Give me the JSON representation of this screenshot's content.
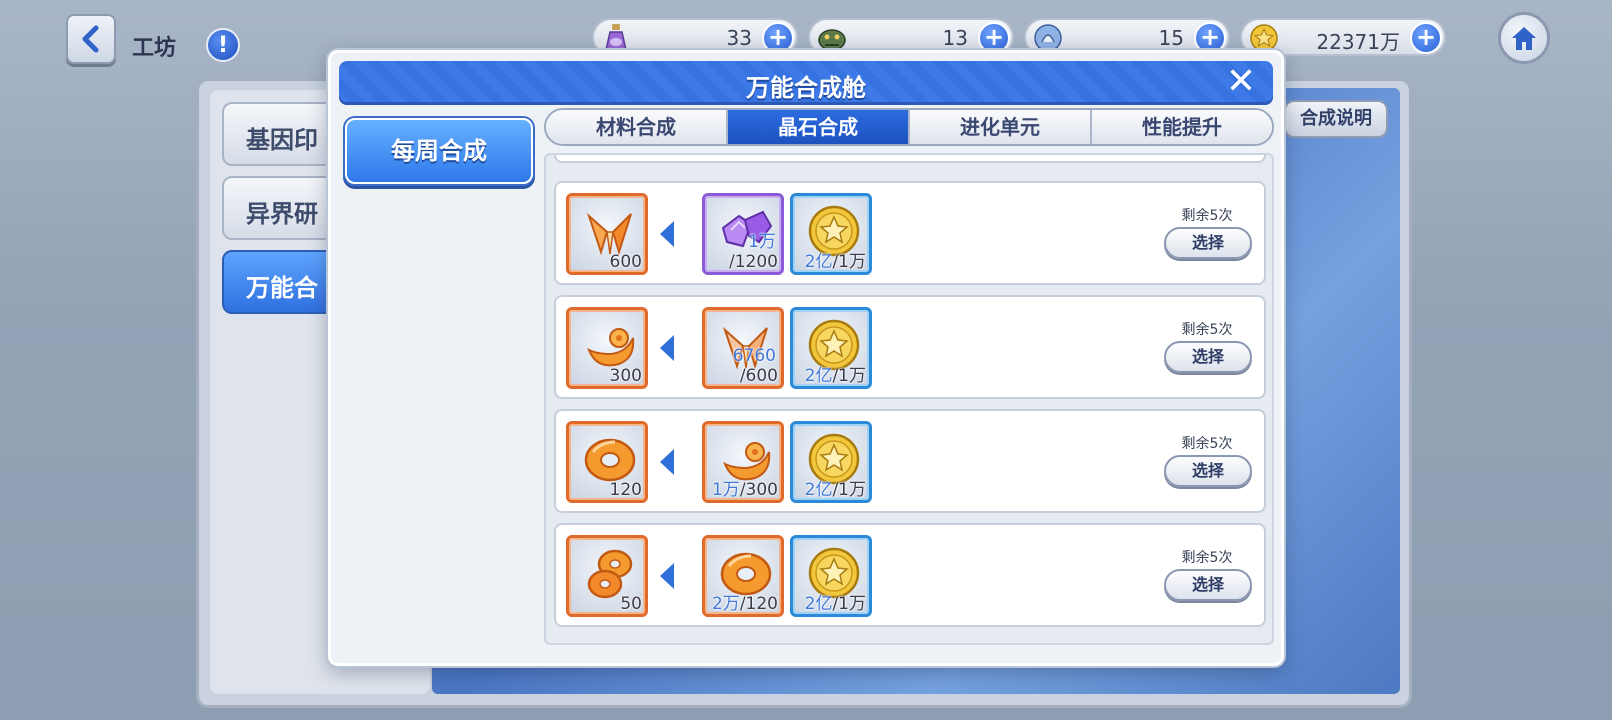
{
  "topbar": {
    "title": "工坊",
    "info_label": "!",
    "resources": [
      {
        "icon": "potion-bottle-icon",
        "value": "33"
      },
      {
        "icon": "dragon-token-icon",
        "value": "13"
      },
      {
        "icon": "badge-coin-icon",
        "value": "15"
      },
      {
        "icon": "gold-coin-icon",
        "value": "22371万"
      }
    ]
  },
  "background": {
    "side_tabs": [
      "基因印",
      "异界研",
      "万能合"
    ],
    "help_button": "合成说明"
  },
  "modal": {
    "title": "万能合成舱",
    "close_label": "✕",
    "weekly_button": "每周合成",
    "tabs": [
      "材料合成",
      "晶石合成",
      "进化单元",
      "性能提升"
    ],
    "active_tab": 1,
    "rows": [
      {
        "result": {
          "icon": "orange-crystal-shard-icon",
          "count": "600"
        },
        "ingredients": [
          {
            "icon": "purple-crystal-icon",
            "have": "1万",
            "need": "/1200",
            "frame": "purple"
          },
          {
            "icon": "gold-star-coin-icon",
            "have": "2亿",
            "need": "/1万",
            "frame": "blue"
          }
        ],
        "remain": "剩余5次",
        "select": "选择"
      },
      {
        "result": {
          "icon": "orange-crescent-icon",
          "count": "300"
        },
        "ingredients": [
          {
            "icon": "orange-crystal-shard-icon",
            "have": "6760",
            "need": "/600",
            "frame": "orange"
          },
          {
            "icon": "gold-star-coin-icon",
            "have": "2亿",
            "need": "/1万",
            "frame": "blue"
          }
        ],
        "remain": "剩余5次",
        "select": "选择"
      },
      {
        "result": {
          "icon": "orange-ring-icon",
          "count": "120"
        },
        "ingredients": [
          {
            "icon": "orange-crescent-icon",
            "have": "1万",
            "need": "/300",
            "frame": "orange"
          },
          {
            "icon": "gold-star-coin-icon",
            "have": "2亿",
            "need": "/1万",
            "frame": "blue"
          }
        ],
        "remain": "剩余5次",
        "select": "选择"
      },
      {
        "result": {
          "icon": "orange-double-ring-icon",
          "count": "50"
        },
        "ingredients": [
          {
            "icon": "orange-ring-icon",
            "have": "2万",
            "need": "/120",
            "frame": "orange"
          },
          {
            "icon": "gold-star-coin-icon",
            "have": "2亿",
            "need": "/1万",
            "frame": "blue"
          }
        ],
        "remain": "剩余5次",
        "select": "选择"
      }
    ]
  },
  "colors": {
    "accent_blue": "#2e6fd8",
    "frame_orange": "#e06a2a",
    "frame_purple": "#8a5ad8",
    "frame_blue": "#2a8ad8"
  }
}
